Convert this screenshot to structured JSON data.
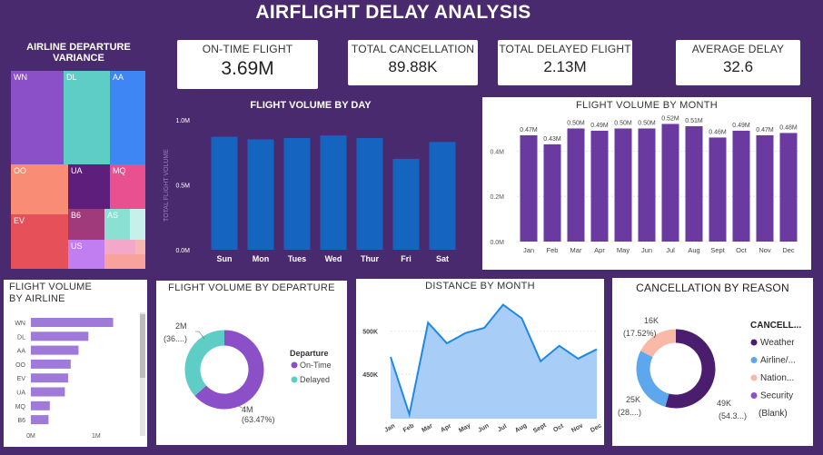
{
  "page_title": "AIRFLIGHT DELAY ANALYSIS",
  "kpis": [
    {
      "label": "ON-TIME FLIGHT",
      "value": "3.69M"
    },
    {
      "label": "TOTAL CANCELLATION",
      "value": "89.88K"
    },
    {
      "label": "TOTAL DELAYED FLIGHT",
      "value": "2.13M"
    },
    {
      "label": "AVERAGE DELAY",
      "value": "32.6"
    }
  ],
  "treemap": {
    "title": "AIRLINE DEPARTURE VARIANCE",
    "labels": {
      "wn": "WN",
      "dl": "DL",
      "aa": "AA",
      "oo": "OO",
      "ua": "UA",
      "mq": "MQ",
      "ev": "EV",
      "b6": "B6",
      "as": "AS",
      "us": "US"
    },
    "colors": {
      "wn": "#8b4fc8",
      "dl": "#5ecdc6",
      "aa": "#3f86f5",
      "oo": "#f88c74",
      "ua": "#5e1f7c",
      "mq": "#e9508f",
      "ev": "#e55059",
      "b6": "#a13a7a",
      "as": "#8be0d4",
      "us": "#c07ef0"
    }
  },
  "chart_data": [
    {
      "type": "bar",
      "title": "FLIGHT VOLUME BY DAY",
      "ylabel": "TOTAL FLIGHT VOLUME",
      "categories": [
        "Sun",
        "Mon",
        "Tues",
        "Wed",
        "Thur",
        "Fri",
        "Sat"
      ],
      "values": [
        0.87,
        0.85,
        0.86,
        0.88,
        0.86,
        0.7,
        0.83
      ],
      "ylim": [
        0,
        1.0
      ],
      "yticks": [
        "0.0M",
        "0.5M",
        "1.0M"
      ],
      "color": "#1565c0"
    },
    {
      "type": "bar",
      "title": "FLIGHT VOLUME BY MONTH",
      "categories": [
        "Jan",
        "Feb",
        "Mar",
        "Apr",
        "May",
        "Jun",
        "Jul",
        "Aug",
        "Sept",
        "Oct",
        "Nov",
        "Dec"
      ],
      "values": [
        0.47,
        0.43,
        0.5,
        0.49,
        0.5,
        0.5,
        0.52,
        0.51,
        0.46,
        0.49,
        0.47,
        0.48
      ],
      "data_labels": [
        "0.47M",
        "0.43M",
        "0.50M",
        "0.49M",
        "0.50M",
        "0.50M",
        "0.52M",
        "0.51M",
        "0.46M",
        "0.49M",
        "0.47M",
        "0.48M"
      ],
      "ylim": [
        0,
        0.55
      ],
      "yticks": [
        "0.0M",
        "0.2M",
        "0.4M"
      ],
      "color": "#6a3aa0"
    },
    {
      "type": "bar",
      "orientation": "horizontal",
      "title": "FLIGHT VOLUME BY AIRLINE",
      "categories": [
        "WN",
        "DL",
        "AA",
        "OO",
        "EV",
        "UA",
        "MQ",
        "B6"
      ],
      "values": [
        1.26,
        0.88,
        0.73,
        0.61,
        0.57,
        0.52,
        0.29,
        0.27
      ],
      "xlim": [
        0,
        1.6
      ],
      "xticks": [
        "0M",
        "1M"
      ],
      "color": "#9f7ad8"
    },
    {
      "type": "pie",
      "title": "FLIGHT VOLUME BY DEPARTURE",
      "legend_title": "Departure",
      "categories": [
        "On-Time",
        "Delayed"
      ],
      "values": [
        63.47,
        36.53
      ],
      "data_labels": [
        "4M",
        "2M"
      ],
      "pct_labels": [
        "(63.47%)",
        "(36....)"
      ],
      "colors": [
        "#8b4fc8",
        "#5ecdc6"
      ]
    },
    {
      "type": "area",
      "title": "DISTANCE BY MONTH",
      "categories": [
        "Jan",
        "Feb",
        "Mar",
        "Apr",
        "May",
        "Jun",
        "Jul",
        "Aug",
        "Sept",
        "Oct",
        "Nov",
        "Dec"
      ],
      "values": [
        470,
        403,
        510,
        486,
        498,
        504,
        531,
        515,
        465,
        483,
        468,
        479
      ],
      "ylim": [
        398,
        540
      ],
      "yticks": [
        "450K",
        "500K"
      ],
      "ytick_values": [
        450,
        500
      ],
      "color": "#1e88e5",
      "fill": "#9ec9f7"
    },
    {
      "type": "pie",
      "title": "CANCELLATION BY REASON",
      "legend_title": "CANCELL...",
      "categories": [
        "Weather",
        "Airline/...",
        "Nation...",
        "Security",
        "(Blank)"
      ],
      "values": [
        54.3,
        28.2,
        17.52,
        0.0,
        0.0
      ],
      "data_labels": [
        "49K",
        "25K",
        "16K"
      ],
      "pct_labels": [
        "(54.3...)",
        "(28....)",
        "(17.52%)"
      ],
      "colors": [
        "#4a1d6e",
        "#5ca7ee",
        "#f9b9a6",
        "#8b4fc8",
        "#ffffff"
      ]
    }
  ]
}
